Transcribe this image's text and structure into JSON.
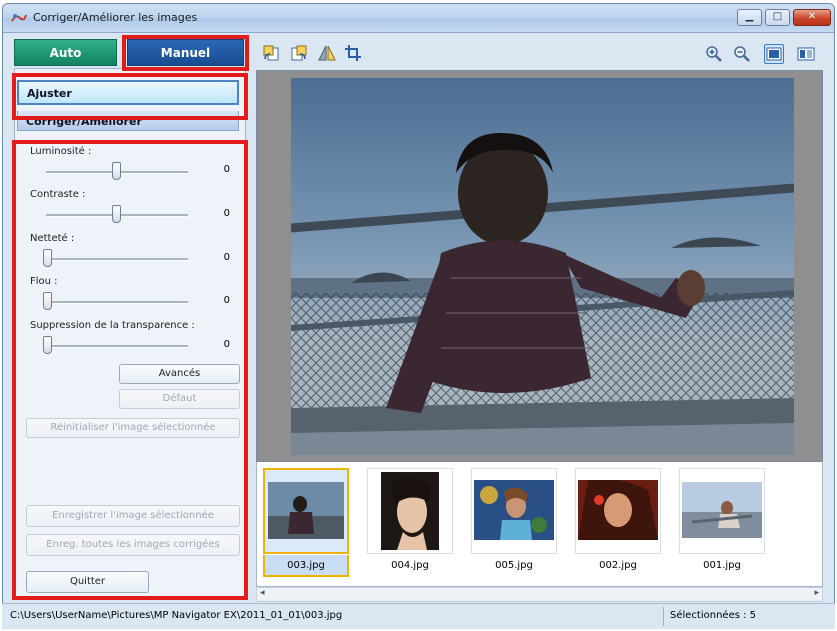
{
  "window": {
    "title": "Corriger/Améliorer les images"
  },
  "tabs": {
    "auto": "Auto",
    "manual": "Manuel"
  },
  "sections": {
    "adjust": "Ajuster",
    "correct": "Corriger/Améliorer"
  },
  "sliders": [
    {
      "label": "Luminosité :",
      "value": "0",
      "level": 0.5
    },
    {
      "label": "Contraste :",
      "value": "0",
      "level": 0.5
    },
    {
      "label": "Netteté :",
      "value": "0",
      "level": 0.0
    },
    {
      "label": "Flou :",
      "value": "0",
      "level": 0.0
    },
    {
      "label": "Suppression de la transparence :",
      "value": "0",
      "level": 0.0
    }
  ],
  "buttons": {
    "advanced": "Avancés",
    "default": "Défaut",
    "reset": "Réinitialiser l'image sélectionnée",
    "save_selected": "Enregistrer l'image sélectionnée",
    "save_all": "Enreg. toutes les images corrigées",
    "quit": "Quitter"
  },
  "thumbnails": [
    {
      "name": "003.jpg",
      "selected": true
    },
    {
      "name": "004.jpg",
      "selected": false
    },
    {
      "name": "005.jpg",
      "selected": false
    },
    {
      "name": "002.jpg",
      "selected": false
    },
    {
      "name": "001.jpg",
      "selected": false
    }
  ],
  "status": {
    "path": "C:\\Users\\UserName\\Pictures\\MP Navigator EX\\2011_01_01\\003.jpg",
    "selected": "Sélectionnées : 5"
  },
  "colors": {
    "highlight": "#e31b1b",
    "auto_tab": "#128261",
    "manual_tab": "#184c93",
    "selection": "#f0b400"
  },
  "icons": [
    "rotate-left-icon",
    "rotate-right-icon",
    "flip-icon",
    "crop-icon",
    "zoom-in-icon",
    "zoom-out-icon",
    "whole-image-view-icon",
    "compare-view-icon"
  ]
}
